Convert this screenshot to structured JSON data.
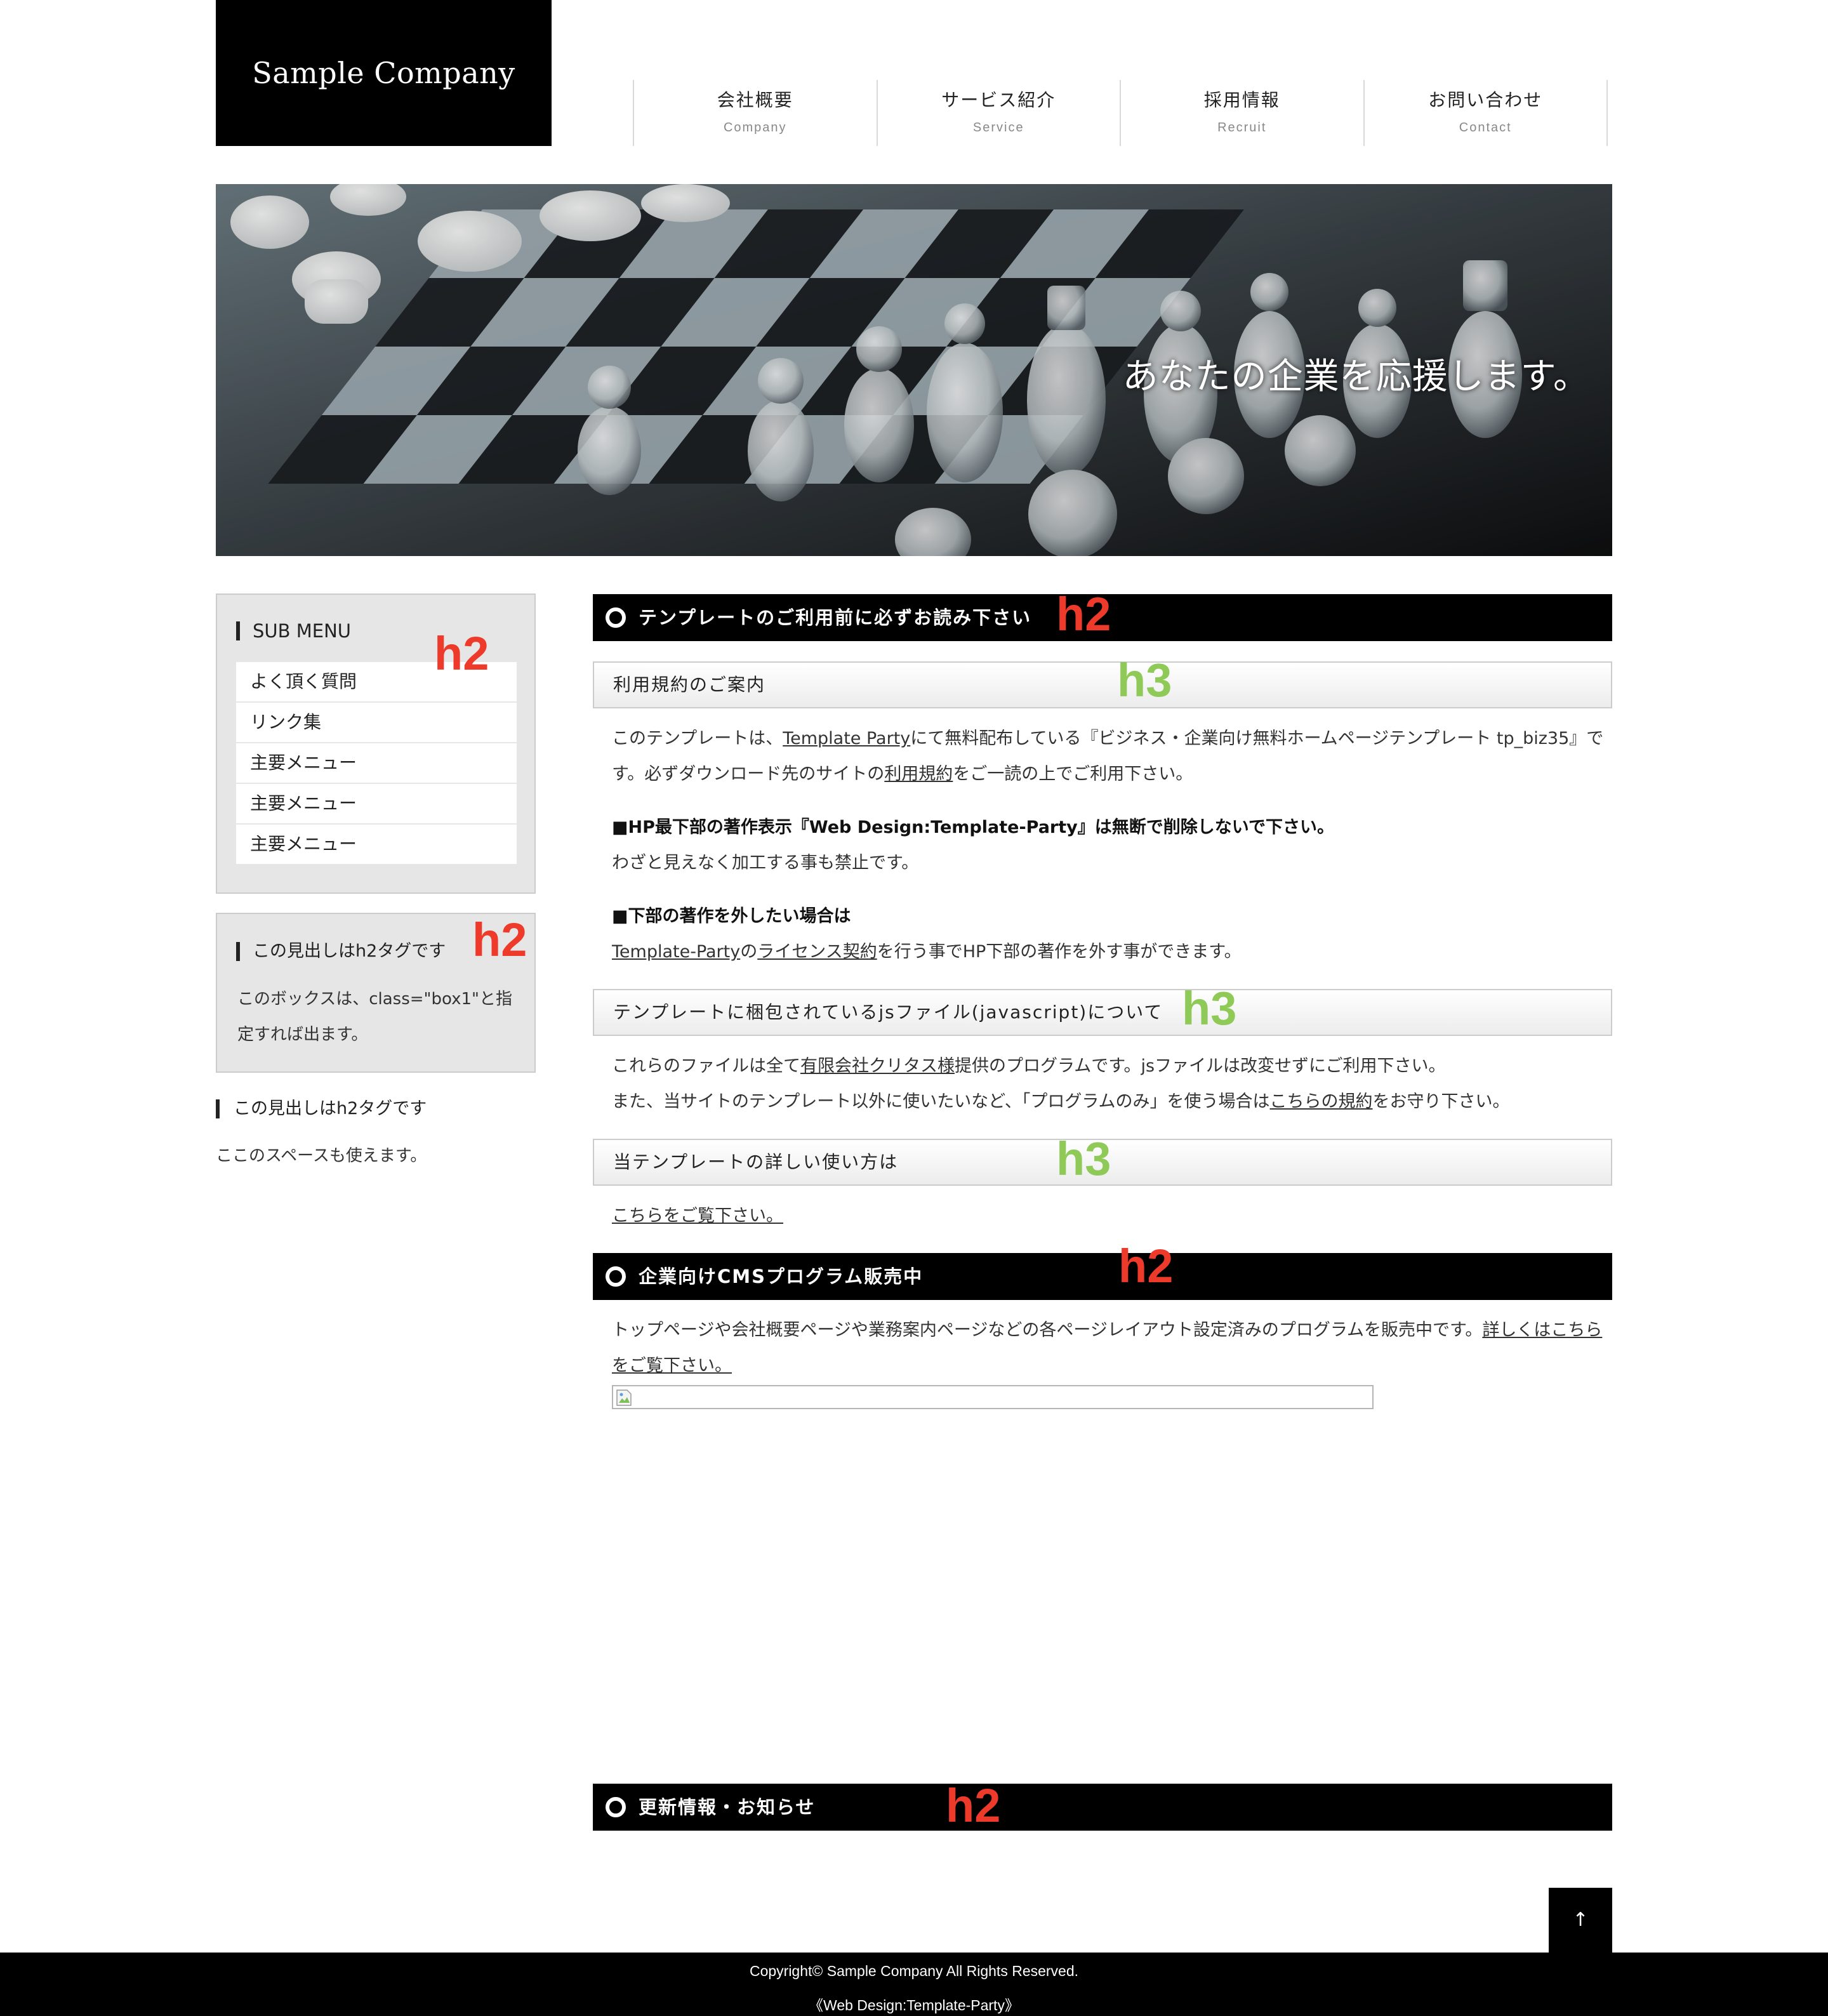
{
  "header": {
    "logo": "Sample Company",
    "nav": [
      {
        "jp": "会社概要",
        "en": "Company"
      },
      {
        "jp": "サービス紹介",
        "en": "Service"
      },
      {
        "jp": "採用情報",
        "en": "Recruit"
      },
      {
        "jp": "お問い合わせ",
        "en": "Contact"
      }
    ]
  },
  "hero": {
    "caption": "あなたの企業を応援します。"
  },
  "sidebar": {
    "submenu_title": "SUB MENU",
    "submenu_items": [
      "よく頂く質問",
      "リンク集",
      "主要メニュー",
      "主要メニュー",
      "主要メニュー"
    ],
    "box1_title": "この見出しはh2タグです",
    "box1_text": "このボックスは、class=\"box1\"と指定すれば出ます。",
    "plain_title": "この見出しはh2タグです",
    "plain_text": "ここのスペースも使えます。"
  },
  "annotations": {
    "h2": "h2",
    "h3": "h3"
  },
  "main": {
    "sec1_title": "テンプレートのご利用前に必ずお読み下さい",
    "sec1_h3": "利用規約のご案内",
    "p1_a": "このテンプレートは、",
    "p1_link1": "Template Party",
    "p1_b": "にて無料配布している『ビジネス・企業向け無料ホームページテンプレート tp_biz35』です。必ずダウンロード先のサイトの",
    "p1_link2": "利用規約",
    "p1_c": "をご一読の上でご利用下さい。",
    "p2_bold": "■HP最下部の著作表示『Web Design:Template-Party』は無断で削除しないで下さい。",
    "p2_text": "わざと見えなく加工する事も禁止です。",
    "p3_bold": "■下部の著作を外したい場合は",
    "p3_link1": "Template-Party",
    "p3_a": "の",
    "p3_link2": "ライセンス契約",
    "p3_b": "を行う事でHP下部の著作を外す事ができます。",
    "js_h3": "テンプレートに梱包されているjsファイル(javascript)について",
    "js_p1_a": "これらのファイルは全て",
    "js_p1_link": "有限会社クリタス様",
    "js_p1_b": "提供のプログラムです。jsファイルは改変せずにご利用下さい。",
    "js_p2_a": "また、当サイトのテンプレート以外に使いたいなど、「プログラムのみ」を使う場合は",
    "js_p2_link": "こちらの規約",
    "js_p2_b": "をお守り下さい。",
    "howto_h3": "当テンプレートの詳しい使い方は",
    "howto_link": "こちらをご覧下さい。",
    "sec2_title": "企業向けCMSプログラム販売中",
    "cms_text": "トップページや会社概要ページや業務案内ページなどの各ページレイアウト設定済みのプログラムを販売中です。",
    "cms_link": "詳しくはこちらをご覧下さい。",
    "sec3_title": "更新情報・お知らせ"
  },
  "pagetop": "↑",
  "footer": {
    "copyright": "Copyright© Sample Company All Rights Reserved.",
    "credit": "《Web Design:Template-Party》"
  }
}
